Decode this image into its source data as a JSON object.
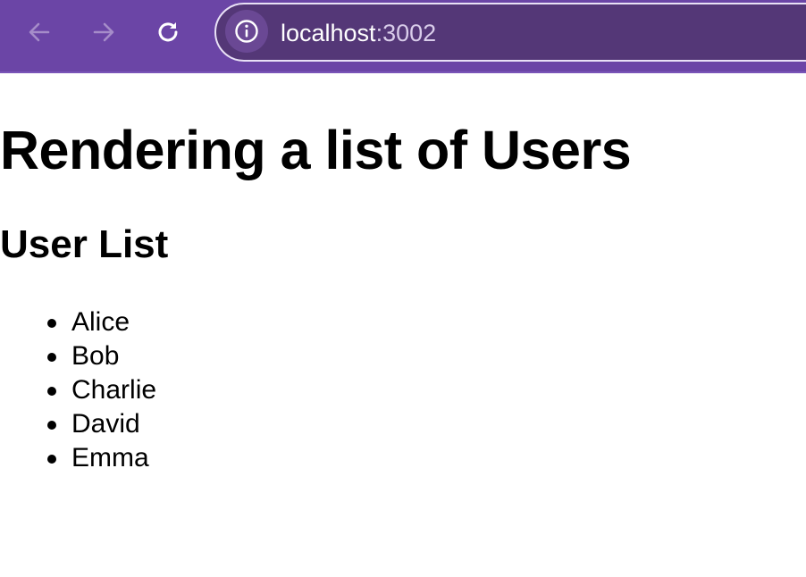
{
  "browser": {
    "url_host": "localhost",
    "url_port": ":3002",
    "toolbar_color": "#6b45a6",
    "urlbar_color": "#543777",
    "icons": [
      "arrow-left-icon",
      "arrow-right-icon",
      "reload-icon",
      "info-icon"
    ]
  },
  "page": {
    "title": "Rendering a list of Users",
    "section_title": "User List",
    "users": [
      "Alice",
      "Bob",
      "Charlie",
      "David",
      "Emma"
    ]
  }
}
